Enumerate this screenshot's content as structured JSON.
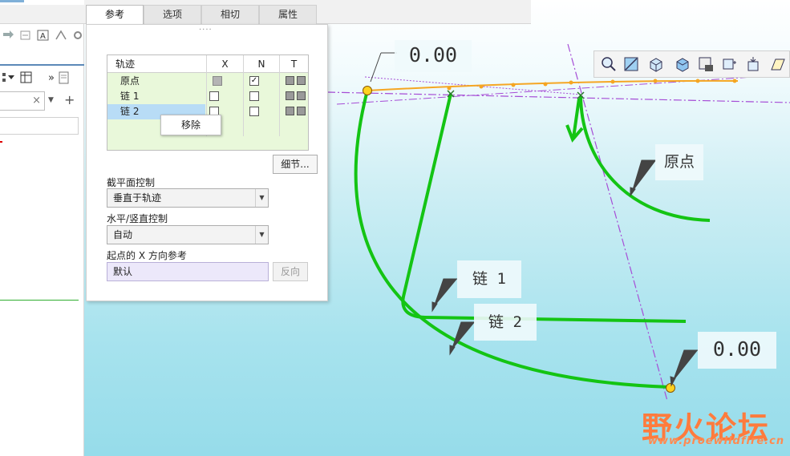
{
  "tabs": [
    {
      "label": "参考",
      "active": true
    },
    {
      "label": "选项",
      "active": false
    },
    {
      "label": "相切",
      "active": false
    },
    {
      "label": "属性",
      "active": false
    }
  ],
  "dialog": {
    "grip": "····",
    "table": {
      "headers": [
        "轨迹",
        "X",
        "N",
        "T"
      ],
      "rows": [
        {
          "name": "原点",
          "x": "gray",
          "n": "checked",
          "t": "squares"
        },
        {
          "name": "链 1",
          "x": "empty",
          "n": "empty",
          "t": "squares"
        },
        {
          "name": "链 2",
          "x": "empty",
          "n": "empty",
          "t": "squares",
          "selected": true
        }
      ],
      "check_glyph": "✓"
    },
    "context_menu": {
      "item": "移除"
    },
    "details_button": "细节...",
    "section_control_label": "截平面控制",
    "section_control_value": "垂直于轨迹",
    "hv_control_label": "水平/竖直控制",
    "hv_control_value": "自动",
    "x_ref_label": "起点的 X 方向参考",
    "x_ref_value": "默认",
    "flip_button": "反向"
  },
  "leftpanel": {
    "chevron": "»"
  },
  "graphics": {
    "dim_top": "0.00",
    "dim_bottom": "0.00",
    "label_origin": "原点",
    "label_chain1": "链 1",
    "label_chain2": "链 2",
    "curve_color": "#14c414",
    "highlight_color": "#f5a623",
    "datum_color": "#a64dd6",
    "arrow_color": "#e8333a"
  },
  "watermark": {
    "main": "野火论坛",
    "sub": "www.proewildfire.cn"
  }
}
